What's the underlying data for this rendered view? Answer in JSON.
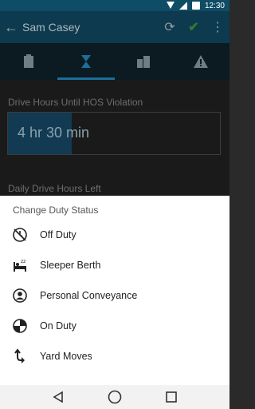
{
  "status_bar": {
    "time": "12:30"
  },
  "app_bar": {
    "title": "Sam Casey"
  },
  "content": {
    "drive_hours_label": "Drive Hours Until HOS Violation",
    "drive_hours_value": "4 hr 30 min",
    "drive_hours_fraction": 0.3,
    "daily_drive_label": "Daily Drive Hours Left"
  },
  "sheet": {
    "title": "Change Duty Status",
    "items": [
      {
        "label": "Off Duty",
        "icon": "off-duty-icon"
      },
      {
        "label": "Sleeper Berth",
        "icon": "sleeper-berth-icon"
      },
      {
        "label": "Personal Conveyance",
        "icon": "personal-conveyance-icon"
      },
      {
        "label": "On Duty",
        "icon": "on-duty-icon"
      },
      {
        "label": "Yard Moves",
        "icon": "yard-moves-icon"
      }
    ]
  },
  "colors": {
    "status_bar": "#0f4c65",
    "app_bar": "#0d3a4f",
    "accent": "#1c6f9a",
    "check": "#2e7d32"
  }
}
